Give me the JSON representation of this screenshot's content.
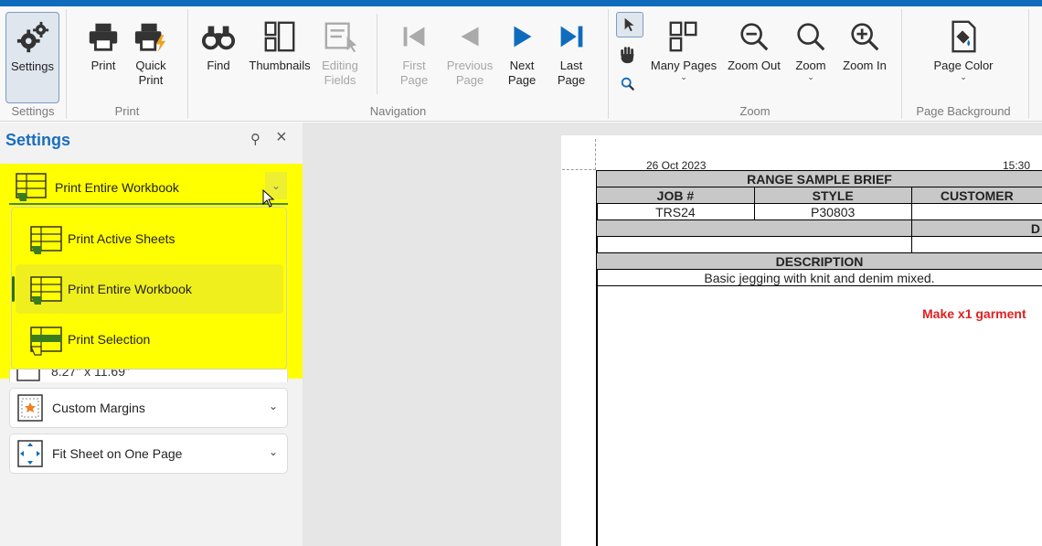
{
  "ribbon": {
    "settings": {
      "label": "Settings",
      "group": "Settings"
    },
    "print": {
      "label": "Print",
      "quick_print": "Quick\nPrint",
      "group": "Print"
    },
    "navigation": {
      "find": "Find",
      "thumbnails": "Thumbnails",
      "editing_fields": "Editing\nFields",
      "first_page": "First\nPage",
      "previous_page": "Previous\nPage",
      "next_page": "Next\nPage",
      "last_page": "Last\nPage",
      "group": "Navigation"
    },
    "zoom": {
      "many_pages": "Many Pages",
      "zoom_out": "Zoom Out",
      "zoom": "Zoom",
      "zoom_in": "Zoom In",
      "group": "Zoom"
    },
    "page_background": {
      "page_color": "Page Color",
      "group": "Page Background"
    }
  },
  "settings_panel": {
    "title": "Settings",
    "print_scope": {
      "selected": "Print Entire Workbook",
      "options": [
        "Print Active Sheets",
        "Print Entire Workbook",
        "Print Selection"
      ]
    },
    "paper_size_partial": "8.27\" x 11.69\"",
    "margins": "Custom Margins",
    "scaling": "Fit Sheet on One Page"
  },
  "preview": {
    "date": "26 Oct 2023",
    "time": "15:30",
    "title": "RANGE SAMPLE BRIEF",
    "col_job": "JOB #",
    "col_style": "STYLE",
    "col_customer": "CUSTOMER",
    "job_value": "TRS24",
    "style_value": "P30803",
    "partial_d": "D",
    "description_label": "DESCRIPTION",
    "description_value": "Basic jegging with knit and denim mixed.",
    "note": "Make x1 garment"
  },
  "colors": {
    "accent": "#0f6cbd",
    "highlight": "#ffff00",
    "note_red": "#e02020"
  }
}
